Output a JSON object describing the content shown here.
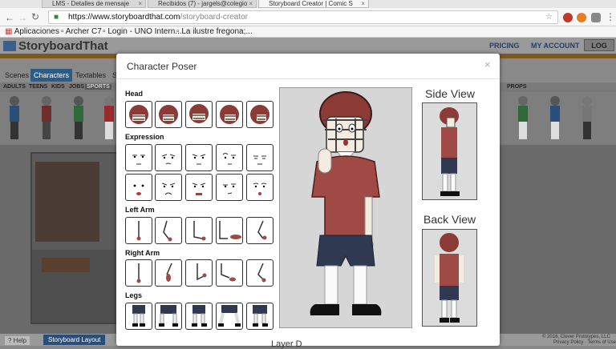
{
  "browser": {
    "tabs": [
      {
        "label": "LMS - Detalles de mensaje"
      },
      {
        "label": "Recibidos (7) - jargels@colegio"
      },
      {
        "label": "Storyboard Creator | Comic S"
      }
    ],
    "url_main": "https://www.storyboardthat.com",
    "url_path": "/storyboard-creator",
    "bookmarks": [
      "Aplicaciones",
      "Archer C7",
      "Login - UNO Intern...",
      "La ilustre fregona;..."
    ]
  },
  "site": {
    "logo": "StoryboardThat",
    "nav": {
      "pricing": "PRICING",
      "account": "MY ACCOUNT",
      "logoff": "LOG OFF"
    },
    "tool_tabs": [
      "Scenes",
      "Characters",
      "Textables",
      "S"
    ],
    "sub_tabs": [
      "ADULTS",
      "TEENS",
      "KIDS",
      "JOBS",
      "SPORTS"
    ],
    "props_label": "PROPS",
    "footer_left": "? Help",
    "footer_layout": "Storyboard Layout",
    "footer_right_1": "© 2016, Clever Prototypes, LLC",
    "footer_right_2": "Privacy Policy · Terms of Use"
  },
  "modal": {
    "title": "Character Poser",
    "close": "×",
    "sections": {
      "head": "Head",
      "expression": "Expression",
      "left_arm": "Left Arm",
      "right_arm": "Right Arm",
      "legs": "Legs"
    },
    "side_view": "Side View",
    "back_view": "Back View",
    "lower_label": "Layer D"
  },
  "colors": {
    "jersey": "#a04a45",
    "helmet": "#8b3a36",
    "shorts": "#2f3a52",
    "accent": "#2a5c86"
  }
}
